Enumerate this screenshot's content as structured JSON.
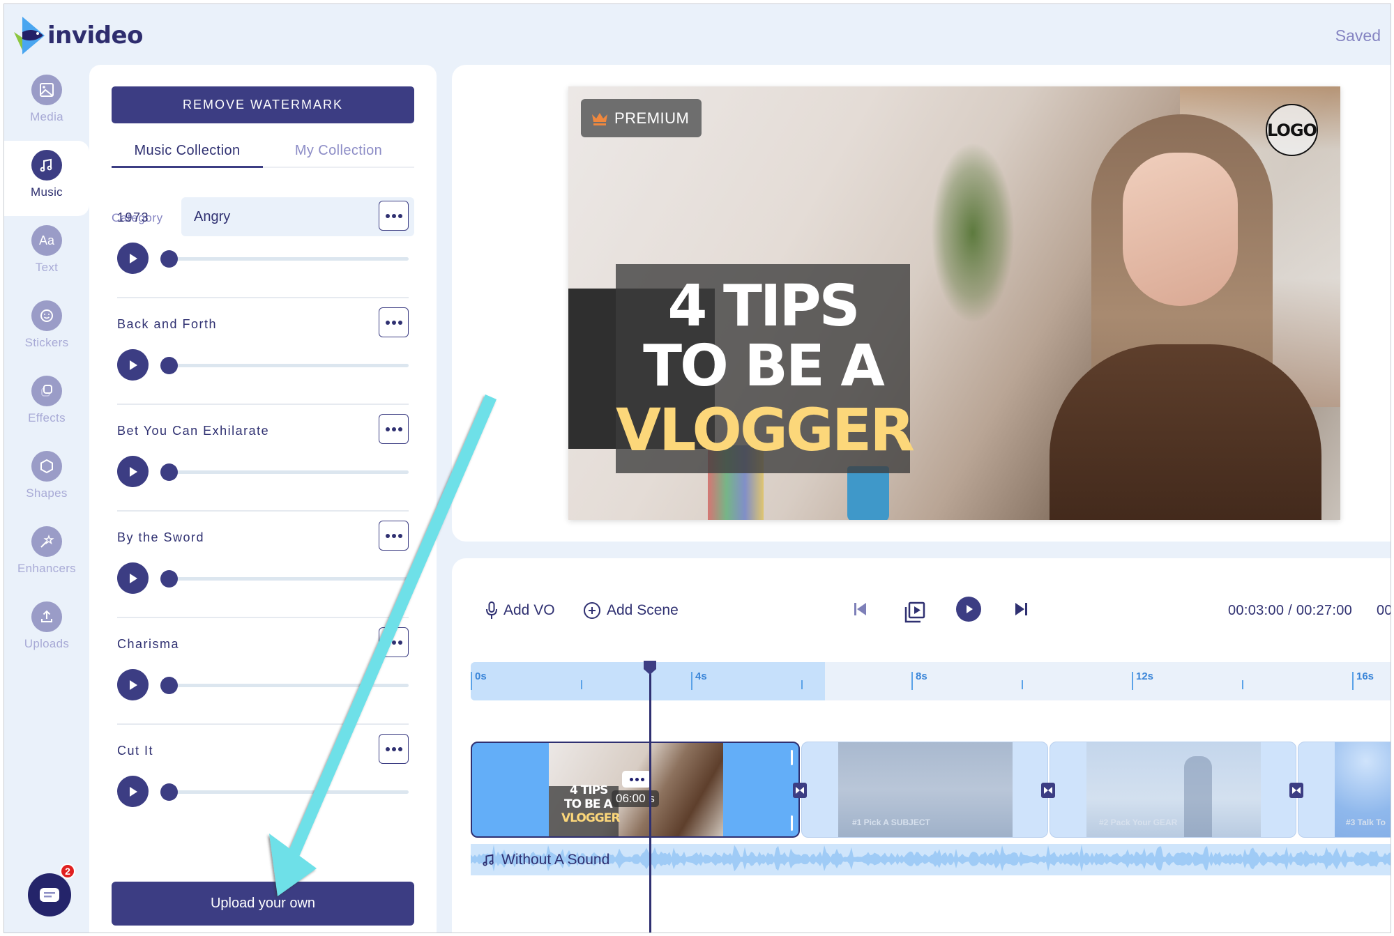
{
  "header": {
    "brand": "invideo",
    "save_status": "Saved"
  },
  "sidebar": {
    "items": [
      {
        "label": "Media",
        "icon": "image-icon",
        "active": false
      },
      {
        "label": "Music",
        "icon": "music-note-icon",
        "active": true
      },
      {
        "label": "Text",
        "icon": "text-aa-icon",
        "active": false
      },
      {
        "label": "Stickers",
        "icon": "smiley-icon",
        "active": false
      },
      {
        "label": "Effects",
        "icon": "layers-icon",
        "active": false
      },
      {
        "label": "Shapes",
        "icon": "hexagon-icon",
        "active": false
      },
      {
        "label": "Enhancers",
        "icon": "magic-wand-icon",
        "active": false
      },
      {
        "label": "Uploads",
        "icon": "upload-icon",
        "active": false
      }
    ],
    "chat_badge_count": "2"
  },
  "music_panel": {
    "remove_watermark_label": "REMOVE WATERMARK",
    "tabs": [
      {
        "label": "Music Collection",
        "active": true
      },
      {
        "label": "My Collection",
        "active": false
      }
    ],
    "category_label": "Category",
    "category_value": "Angry",
    "tracks": [
      {
        "name": "1973",
        "progress": 0
      },
      {
        "name": "Back and Forth",
        "progress": 0
      },
      {
        "name": "Bet You Can Exhilarate",
        "progress": 0
      },
      {
        "name": "By the Sword",
        "progress": 0
      },
      {
        "name": "Charisma",
        "progress": 0
      },
      {
        "name": "Cut It",
        "progress": 0
      }
    ],
    "upload_label": "Upload your own"
  },
  "preview": {
    "premium_label": "PREMIUM",
    "logo_placeholder": "LOGO",
    "title_lines": [
      "4 TIPS",
      "TO BE A",
      "VLOGGER"
    ],
    "title_accent_color": "#fcd77a"
  },
  "timeline": {
    "add_vo_label": "Add VO",
    "add_scene_label": "Add Scene",
    "current_time": "00:03:00",
    "total_time": "00:27:00",
    "time_readout": "00:03:00 / 00:27:00",
    "time_overflow": "00",
    "ruler_labels": [
      "0s",
      "4s",
      "8s",
      "12s",
      "16s"
    ],
    "playhead_seconds": 3.2,
    "clips": [
      {
        "title": "4 TIPS TO BE A VLOGGER",
        "duration_label": "06:00 s",
        "active": true
      },
      {
        "title": "#1 Pick A SUBJECT",
        "active": false
      },
      {
        "title": "#2 Pack Your GEAR",
        "active": false
      },
      {
        "title": "#3 Talk To",
        "active": false
      }
    ],
    "audio_track_label": "Without A Sound"
  },
  "colors": {
    "primary": "#3c3d83",
    "background": "#eaf1fa",
    "annotation_arrow": "#6ee0e8"
  }
}
